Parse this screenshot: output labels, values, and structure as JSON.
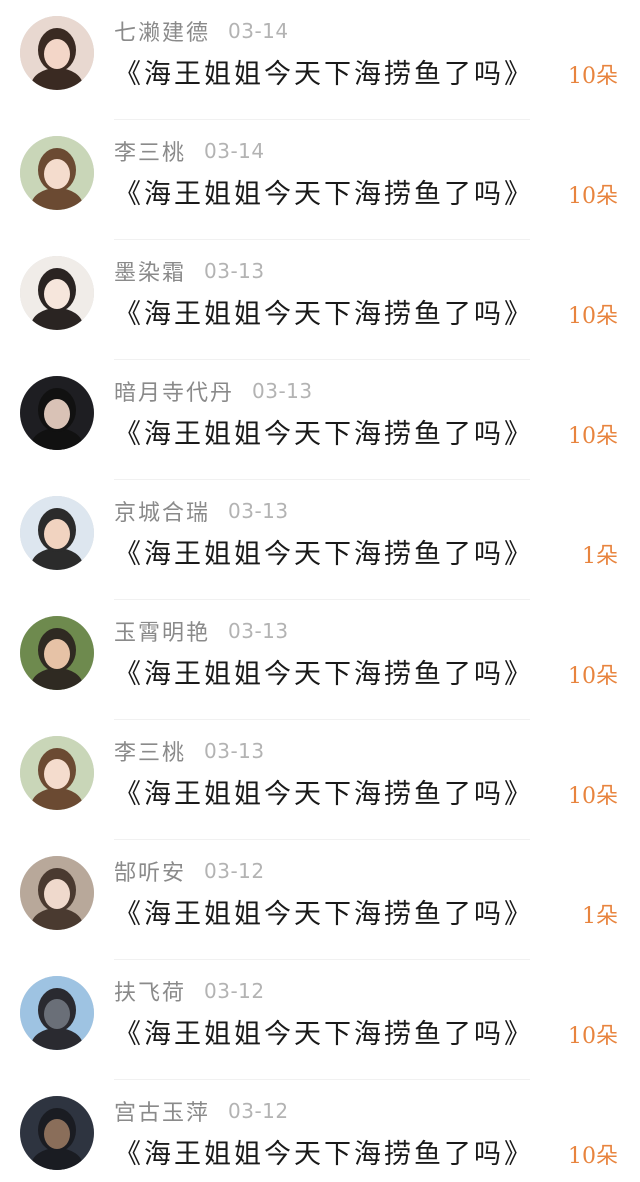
{
  "entries": [
    {
      "name": "七濑建德",
      "date": "03-14",
      "title": "《海王姐姐今天下海捞鱼了吗》",
      "gift": "10朵",
      "avatar": {
        "bg": "#e8d8d0",
        "hair": "#3a2a22",
        "face": "#f3d6c8"
      }
    },
    {
      "name": "李三桃",
      "date": "03-14",
      "title": "《海王姐姐今天下海捞鱼了吗》",
      "gift": "10朵",
      "avatar": {
        "bg": "#c9d6b8",
        "hair": "#6b4a32",
        "face": "#f4dccd"
      }
    },
    {
      "name": "墨染霜",
      "date": "03-13",
      "title": "《海王姐姐今天下海捞鱼了吗》",
      "gift": "10朵",
      "avatar": {
        "bg": "#f0ece8",
        "hair": "#2a2422",
        "face": "#f6e6dc"
      }
    },
    {
      "name": "暗月寺代丹",
      "date": "03-13",
      "title": "《海王姐姐今天下海捞鱼了吗》",
      "gift": "10朵",
      "avatar": {
        "bg": "#1e1e22",
        "hair": "#111111",
        "face": "#d9c2b6"
      }
    },
    {
      "name": "京城合瑞",
      "date": "03-13",
      "title": "《海王姐姐今天下海捞鱼了吗》",
      "gift": "1朵",
      "avatar": {
        "bg": "#dde6ef",
        "hair": "#2b2b2b",
        "face": "#f1d3c0"
      }
    },
    {
      "name": "玉霄明艳",
      "date": "03-13",
      "title": "《海王姐姐今天下海捞鱼了吗》",
      "gift": "10朵",
      "avatar": {
        "bg": "#6e8a4e",
        "hair": "#2f2a22",
        "face": "#e6c2a6"
      }
    },
    {
      "name": "李三桃",
      "date": "03-13",
      "title": "《海王姐姐今天下海捞鱼了吗》",
      "gift": "10朵",
      "avatar": {
        "bg": "#c9d6b8",
        "hair": "#6b4a32",
        "face": "#f4dccd"
      }
    },
    {
      "name": "郜听安",
      "date": "03-12",
      "title": "《海王姐姐今天下海捞鱼了吗》",
      "gift": "1朵",
      "avatar": {
        "bg": "#b8a89a",
        "hair": "#4a3a30",
        "face": "#efd9cc"
      }
    },
    {
      "name": "扶飞荷",
      "date": "03-12",
      "title": "《海王姐姐今天下海捞鱼了吗》",
      "gift": "10朵",
      "avatar": {
        "bg": "#9ec3e2",
        "hair": "#2a2a30",
        "face": "#6a6f78"
      }
    },
    {
      "name": "宫古玉萍",
      "date": "03-12",
      "title": "《海王姐姐今天下海捞鱼了吗》",
      "gift": "10朵",
      "avatar": {
        "bg": "#2e3440",
        "hair": "#1a1c22",
        "face": "#8a6e5a"
      }
    }
  ],
  "colors": {
    "name": "#8a8a8a",
    "date": "#b3b3b3",
    "title": "#1a1a1a",
    "gift": "#e8843e",
    "divider": "#f1f1f1"
  },
  "icons": {
    "avatar": "user-avatar-photo"
  }
}
